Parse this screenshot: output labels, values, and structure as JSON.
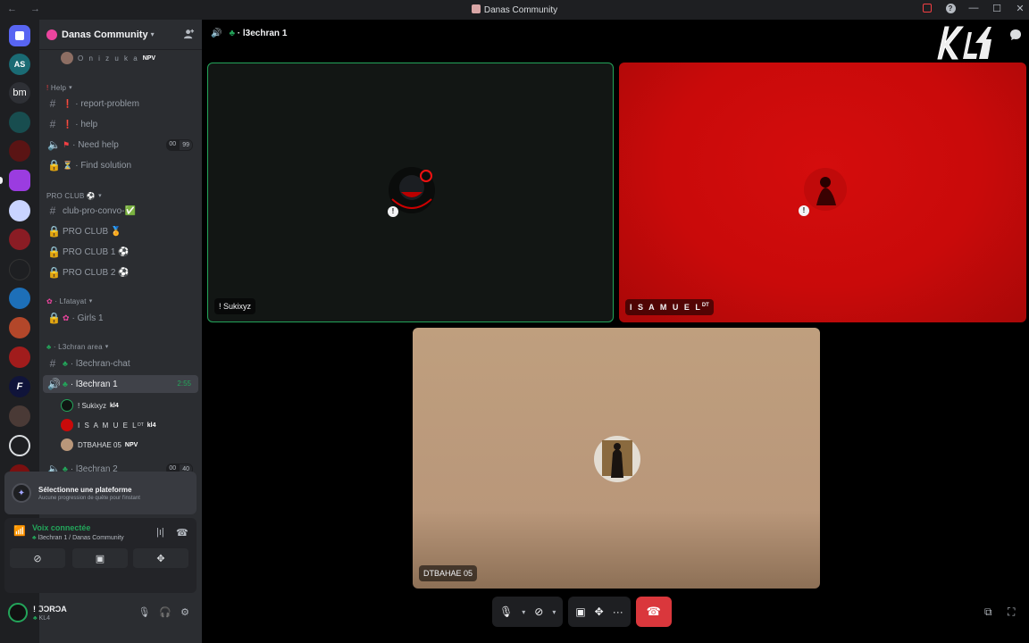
{
  "window": {
    "title": "Danas Community",
    "nav_arrows": "← →"
  },
  "server": {
    "name": "Danas Community"
  },
  "channels": {
    "partial_user": {
      "name": "O n i z u k a",
      "tag": "NPV"
    },
    "help_category": "Help",
    "report_problem": "report-problem",
    "help": "help",
    "need_help": "Need help",
    "need_help_count_a": "00",
    "need_help_count_b": "99",
    "find_solution": "Find solution",
    "pro_category": "PRO CLUB",
    "club_pro_convo": "club-pro-convo-",
    "pro_club": "PRO CLUB",
    "pro_club_1": "PRO CLUB 1",
    "pro_club_2": "PRO CLUB 2",
    "lfatayat_category": "Lfatayat",
    "girls_1": "Girls 1",
    "l3echran_category": "L3chran area",
    "l3echran_chat": "l3echran-chat",
    "l3echran_1": "l3echran 1",
    "l3echran_1_timer": "2:55",
    "voice_users": [
      {
        "name": "! Sukixyz",
        "tag": "kl4"
      },
      {
        "name": "I S A M U E L",
        "sup": "DT",
        "tag": "kl4"
      },
      {
        "name": "DTBAHAE 05",
        "tag": "NPV"
      }
    ],
    "l3echran_2": "l3echran 2",
    "l3echran_2_count_a": "00",
    "l3echran_2_count_b": "40"
  },
  "quest": {
    "title": "Sélectionne une plateforme",
    "subtitle": "Aucune progression de quête pour l'instant"
  },
  "voice_panel": {
    "status": "Voix connectée",
    "location": "l3echran 1 / Danas Community"
  },
  "user_panel": {
    "name": "! ℑƆRƆA",
    "status": "KL4"
  },
  "stage": {
    "channel": "l3echran 1",
    "tiles": [
      {
        "name": "! Sukixyz"
      },
      {
        "name": "I S A M U E L",
        "sup": "DT"
      },
      {
        "name": "DTBAHAE 05"
      }
    ]
  },
  "rail": {
    "item_bm": "bm",
    "item_as": "AS",
    "item_f": "F"
  },
  "colors": {
    "accent_green": "#23a55a",
    "danger": "#da373c",
    "brand": "#5865f2"
  }
}
